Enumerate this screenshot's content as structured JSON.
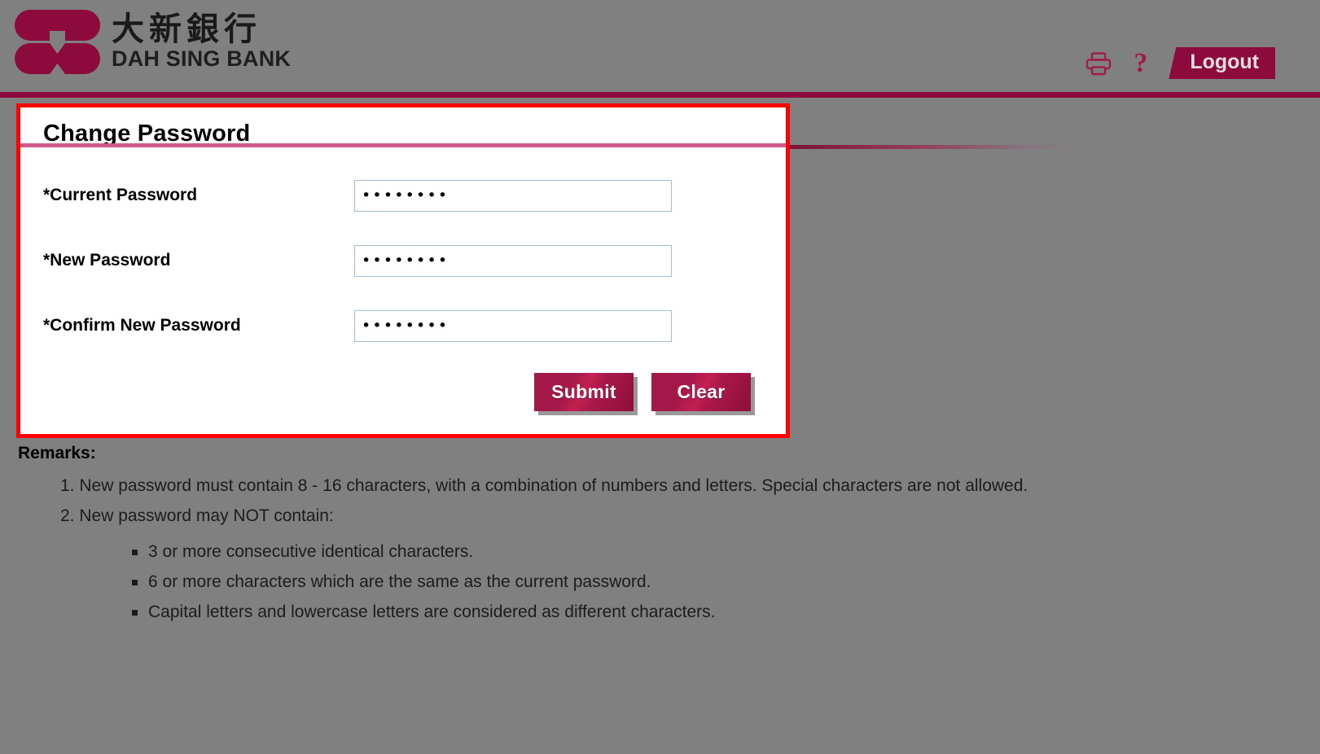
{
  "brand": {
    "name_cn": "大新銀行",
    "name_en": "DAH SING BANK",
    "logo_icon": "dah-sing-logo-icon",
    "accent_color": "#8C0A3C",
    "underline_color": "#D1588A"
  },
  "header": {
    "print_icon": "printer-icon",
    "help_icon": "question-mark-icon",
    "help_label": "?",
    "logout_label": "Logout"
  },
  "form": {
    "title": "Change Password",
    "fields": [
      {
        "label": "*Current Password",
        "value": "••••••••",
        "placeholder": "",
        "name": "current-password"
      },
      {
        "label": "*New Password",
        "value": "••••••••",
        "placeholder": "",
        "name": "new-password"
      },
      {
        "label": "*Confirm New Password",
        "value": "••••••••",
        "placeholder": "",
        "name": "confirm-new-password"
      }
    ],
    "submit_label": "Submit",
    "clear_label": "Clear"
  },
  "remarks": {
    "title": "Remarks:",
    "items": [
      "1. New password must contain 8 - 16 characters, with a combination of numbers and letters. Special characters are not allowed.",
      "2. New password may NOT contain:"
    ],
    "sub_items": [
      "3 or more consecutive identical characters.",
      "6 or more characters which are the same as the current password.",
      "Capital letters and lowercase letters are considered as different characters."
    ]
  },
  "annotation": {
    "highlight_color": "#FF0000"
  }
}
